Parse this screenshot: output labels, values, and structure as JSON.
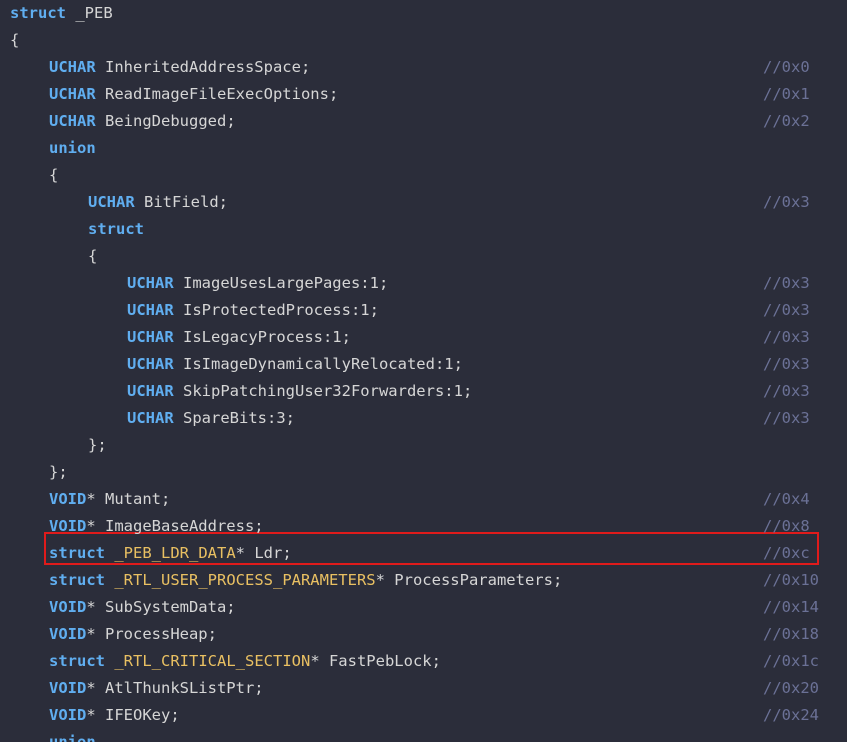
{
  "colors": {
    "background": "#2b2d3a",
    "keyword": "#60aef0",
    "type_name": "#e9c062",
    "text": "#d6d6d6",
    "comment": "#6b7196",
    "highlight_border": "#e01b1b"
  },
  "code": {
    "lines": [
      {
        "indent": 0,
        "tokens": [
          {
            "t": "struct",
            "k": "kw"
          },
          {
            "t": " _PEB",
            "k": "id"
          }
        ],
        "comment": ""
      },
      {
        "indent": 0,
        "tokens": [
          {
            "t": "{",
            "k": "punc"
          }
        ],
        "comment": ""
      },
      {
        "indent": 1,
        "tokens": [
          {
            "t": "UCHAR",
            "k": "kw"
          },
          {
            "t": " InheritedAddressSpace;",
            "k": "id"
          }
        ],
        "comment": "//0x0"
      },
      {
        "indent": 1,
        "tokens": [
          {
            "t": "UCHAR",
            "k": "kw"
          },
          {
            "t": " ReadImageFileExecOptions;",
            "k": "id"
          }
        ],
        "comment": "//0x1"
      },
      {
        "indent": 1,
        "tokens": [
          {
            "t": "UCHAR",
            "k": "kw"
          },
          {
            "t": " BeingDebugged;",
            "k": "id"
          }
        ],
        "comment": "//0x2"
      },
      {
        "indent": 1,
        "tokens": [
          {
            "t": "union",
            "k": "kw"
          }
        ],
        "comment": ""
      },
      {
        "indent": 1,
        "tokens": [
          {
            "t": "{",
            "k": "punc"
          }
        ],
        "comment": ""
      },
      {
        "indent": 2,
        "tokens": [
          {
            "t": "UCHAR",
            "k": "kw"
          },
          {
            "t": " BitField;",
            "k": "id"
          }
        ],
        "comment": "//0x3"
      },
      {
        "indent": 2,
        "tokens": [
          {
            "t": "struct",
            "k": "kw"
          }
        ],
        "comment": ""
      },
      {
        "indent": 2,
        "tokens": [
          {
            "t": "{",
            "k": "punc"
          }
        ],
        "comment": ""
      },
      {
        "indent": 3,
        "tokens": [
          {
            "t": "UCHAR",
            "k": "kw"
          },
          {
            "t": " ImageUsesLargePages:1;",
            "k": "id"
          }
        ],
        "comment": "//0x3"
      },
      {
        "indent": 3,
        "tokens": [
          {
            "t": "UCHAR",
            "k": "kw"
          },
          {
            "t": " IsProtectedProcess:1;",
            "k": "id"
          }
        ],
        "comment": "//0x3"
      },
      {
        "indent": 3,
        "tokens": [
          {
            "t": "UCHAR",
            "k": "kw"
          },
          {
            "t": " IsLegacyProcess:1;",
            "k": "id"
          }
        ],
        "comment": "//0x3"
      },
      {
        "indent": 3,
        "tokens": [
          {
            "t": "UCHAR",
            "k": "kw"
          },
          {
            "t": " IsImageDynamicallyRelocated:1;",
            "k": "id"
          }
        ],
        "comment": "//0x3"
      },
      {
        "indent": 3,
        "tokens": [
          {
            "t": "UCHAR",
            "k": "kw"
          },
          {
            "t": " SkipPatchingUser32Forwarders:1;",
            "k": "id"
          }
        ],
        "comment": "//0x3"
      },
      {
        "indent": 3,
        "tokens": [
          {
            "t": "UCHAR",
            "k": "kw"
          },
          {
            "t": " SpareBits:3;",
            "k": "id"
          }
        ],
        "comment": "//0x3"
      },
      {
        "indent": 2,
        "tokens": [
          {
            "t": "};",
            "k": "punc"
          }
        ],
        "comment": ""
      },
      {
        "indent": 1,
        "tokens": [
          {
            "t": "};",
            "k": "punc"
          }
        ],
        "comment": ""
      },
      {
        "indent": 1,
        "tokens": [
          {
            "t": "VOID",
            "k": "kw"
          },
          {
            "t": "* Mutant;",
            "k": "id"
          }
        ],
        "comment": "//0x4"
      },
      {
        "indent": 1,
        "tokens": [
          {
            "t": "VOID",
            "k": "kw"
          },
          {
            "t": "* ImageBaseAddress;",
            "k": "id"
          }
        ],
        "comment": "//0x8"
      },
      {
        "indent": 1,
        "tokens": [
          {
            "t": "struct",
            "k": "kw"
          },
          {
            "t": " ",
            "k": "id"
          },
          {
            "t": "_PEB_LDR_DATA",
            "k": "ty"
          },
          {
            "t": "* Ldr;",
            "k": "id"
          }
        ],
        "comment": "//0xc",
        "highlighted": true
      },
      {
        "indent": 1,
        "tokens": [
          {
            "t": "struct",
            "k": "kw"
          },
          {
            "t": " ",
            "k": "id"
          },
          {
            "t": "_RTL_USER_PROCESS_PARAMETERS",
            "k": "ty"
          },
          {
            "t": "* ProcessParameters;",
            "k": "id"
          }
        ],
        "comment": "//0x10"
      },
      {
        "indent": 1,
        "tokens": [
          {
            "t": "VOID",
            "k": "kw"
          },
          {
            "t": "* SubSystemData;",
            "k": "id"
          }
        ],
        "comment": "//0x14"
      },
      {
        "indent": 1,
        "tokens": [
          {
            "t": "VOID",
            "k": "kw"
          },
          {
            "t": "* ProcessHeap;",
            "k": "id"
          }
        ],
        "comment": "//0x18"
      },
      {
        "indent": 1,
        "tokens": [
          {
            "t": "struct",
            "k": "kw"
          },
          {
            "t": " ",
            "k": "id"
          },
          {
            "t": "_RTL_CRITICAL_SECTION",
            "k": "ty"
          },
          {
            "t": "* FastPebLock;",
            "k": "id"
          }
        ],
        "comment": "//0x1c"
      },
      {
        "indent": 1,
        "tokens": [
          {
            "t": "VOID",
            "k": "kw"
          },
          {
            "t": "* AtlThunkSListPtr;",
            "k": "id"
          }
        ],
        "comment": "//0x20"
      },
      {
        "indent": 1,
        "tokens": [
          {
            "t": "VOID",
            "k": "kw"
          },
          {
            "t": "* IFEOKey;",
            "k": "id"
          }
        ],
        "comment": "//0x24"
      },
      {
        "indent": 1,
        "tokens": [
          {
            "t": "union",
            "k": "kw"
          }
        ],
        "comment": ""
      }
    ]
  }
}
